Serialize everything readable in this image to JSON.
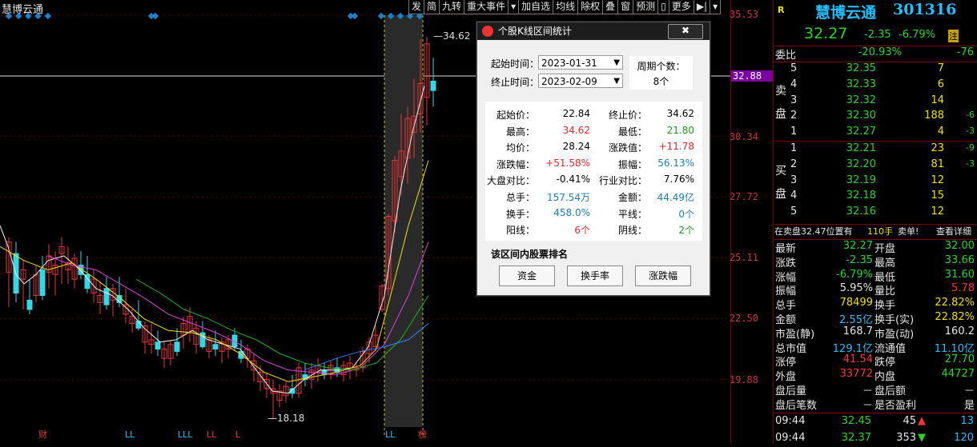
{
  "stock_tag": "慧博云通",
  "toolbar": [
    "发",
    "简",
    "九转",
    "重大事件",
    "▾",
    "加自选",
    "均线",
    "除权",
    "叠",
    "窗",
    "预测",
    "▯",
    "更多",
    "▶|",
    "▾"
  ],
  "axis": {
    "ticks": [
      "35.53",
      "30.34",
      "27.72",
      "25.11",
      "22.50",
      "19.88"
    ],
    "current": "32.88"
  },
  "chart_labels": {
    "high": "34.62",
    "low": "18.18",
    "markers": [
      "财",
      "LL",
      "LLL",
      "LL",
      "L",
      "LL",
      "榜"
    ]
  },
  "dialog": {
    "title": "个股K线区间统计",
    "close": "✖",
    "start_label": "起始时间：",
    "start_value": "2023-01-31",
    "end_label": "终止时间：",
    "end_value": "2023-02-09",
    "period_label": "周期个数：",
    "period_value": "8个",
    "stats": [
      {
        "l": "起始价：",
        "v": "22.84",
        "c": "blk",
        "l2": "终止价：",
        "v2": "34.62",
        "c2": "blk"
      },
      {
        "l": "最高：",
        "v": "34.62",
        "c": "red",
        "l2": "最低：",
        "v2": "21.80",
        "c2": "grn"
      },
      {
        "l": "均价：",
        "v": "28.24",
        "c": "blk",
        "l2": "涨跌值：",
        "v2": "+11.78",
        "c2": "red"
      },
      {
        "l": "涨跌幅：",
        "v": "+51.58%",
        "c": "red",
        "l2": "振幅：",
        "v2": "56.13%",
        "c2": "blu"
      },
      {
        "l": "大盘对比：",
        "v": "-0.41%",
        "c": "blk",
        "l2": "行业对比：",
        "v2": "7.76%",
        "c2": "blk"
      },
      {
        "l": "总手：",
        "v": "157.54万",
        "c": "blu",
        "l2": "金额：",
        "v2": "44.49亿",
        "c2": "blu"
      },
      {
        "l": "换手：",
        "v": "458.0%",
        "c": "blu",
        "l2": "平线：",
        "v2": "0个",
        "c2": "blu"
      },
      {
        "l": "阳线：",
        "v": "6个",
        "c": "red",
        "l2": "阴线：",
        "v2": "2个",
        "c2": "grn"
      }
    ],
    "rank_header": "该区间内股票排名",
    "buttons": [
      "资金",
      "换手率",
      "涨跌幅"
    ]
  },
  "panel": {
    "r_mark": "R",
    "name": "慧博云通",
    "code": "301316",
    "price": "32.27",
    "change": "-2.35",
    "pct": "-6.79%",
    "badge": "注",
    "wb_label": "委比",
    "wb_val": "-20.93%",
    "wb_diff": "-76",
    "sell_label": [
      "卖",
      "盘"
    ],
    "buy_label": [
      "买",
      "盘"
    ],
    "asks": [
      {
        "n": "5",
        "p": "32.35",
        "v": "7",
        "d": ""
      },
      {
        "n": "4",
        "p": "32.33",
        "v": "6",
        "d": ""
      },
      {
        "n": "3",
        "p": "32.32",
        "v": "14",
        "d": ""
      },
      {
        "n": "2",
        "p": "32.30",
        "v": "188",
        "d": "-6"
      },
      {
        "n": "1",
        "p": "32.27",
        "v": "4",
        "d": "-3"
      }
    ],
    "bids": [
      {
        "n": "1",
        "p": "32.21",
        "v": "23",
        "d": "-9"
      },
      {
        "n": "2",
        "p": "32.20",
        "v": "81",
        "d": "-3"
      },
      {
        "n": "3",
        "p": "32.19",
        "v": "12",
        "d": ""
      },
      {
        "n": "4",
        "p": "32.18",
        "v": "15",
        "d": ""
      },
      {
        "n": "5",
        "p": "32.16",
        "v": "12",
        "d": ""
      }
    ],
    "notice": "在卖盘32.47位置有",
    "notice_qty": "110手",
    "notice_sell": "卖单!",
    "notice_link": "查看详细",
    "quotes": [
      {
        "l": "最新",
        "v": "32.27",
        "vc": "gg",
        "l2": "开盘",
        "v2": "32.00",
        "v2c": "gg"
      },
      {
        "l": "涨跌",
        "v": "-2.35",
        "vc": "gg",
        "l2": "最高",
        "v2": "33.66",
        "v2c": "gg"
      },
      {
        "l": "涨幅",
        "v": "-6.79%",
        "vc": "gg",
        "l2": "最低",
        "v2": "31.60",
        "v2c": "gg"
      },
      {
        "l": "振幅",
        "v": "5.95%",
        "vc": "w",
        "l2": "量比",
        "v2": "5.78",
        "v2c": "rr"
      },
      {
        "l": "总手",
        "v": "78499",
        "vc": "yellow",
        "l2": "换手",
        "v2": "22.82%",
        "v2c": "yellow"
      },
      {
        "l": "金额",
        "v": "2.55亿",
        "vc": "cy",
        "l2": "换手(实)",
        "v2": "22.82%",
        "v2c": "yellow"
      },
      {
        "l": "市盈(静)",
        "v": "168.7",
        "vc": "w",
        "l2": "市盈(动)",
        "v2": "160.2",
        "v2c": "w"
      },
      {
        "l": "总市值",
        "v": "129.1亿",
        "vc": "cy",
        "l2": "流通值",
        "v2": "11.10亿",
        "v2c": "cy"
      },
      {
        "l": "涨停",
        "v": "41.54",
        "vc": "rr",
        "l2": "跌停",
        "v2": "27.70",
        "v2c": "gg"
      },
      {
        "l": "外盘",
        "v": "33772",
        "vc": "rr",
        "l2": "内盘",
        "v2": "44727",
        "v2c": "gg"
      },
      {
        "l": "盘后量",
        "v": "－",
        "vc": "w",
        "l2": "盘后额",
        "v2": "－",
        "v2c": "w"
      },
      {
        "l": "盘后笔数",
        "v": "－",
        "vc": "w",
        "l2": "是否盈利",
        "v2": "是",
        "v2c": "w"
      }
    ],
    "ticks": [
      {
        "t": "09:44",
        "p": "32.45",
        "v": "45",
        "arrow": "▲",
        "ac": "rr",
        "n": "13"
      },
      {
        "t": "09:44",
        "p": "32.37",
        "v": "353",
        "arrow": "▼",
        "ac": "gg",
        "n": "120"
      }
    ]
  }
}
